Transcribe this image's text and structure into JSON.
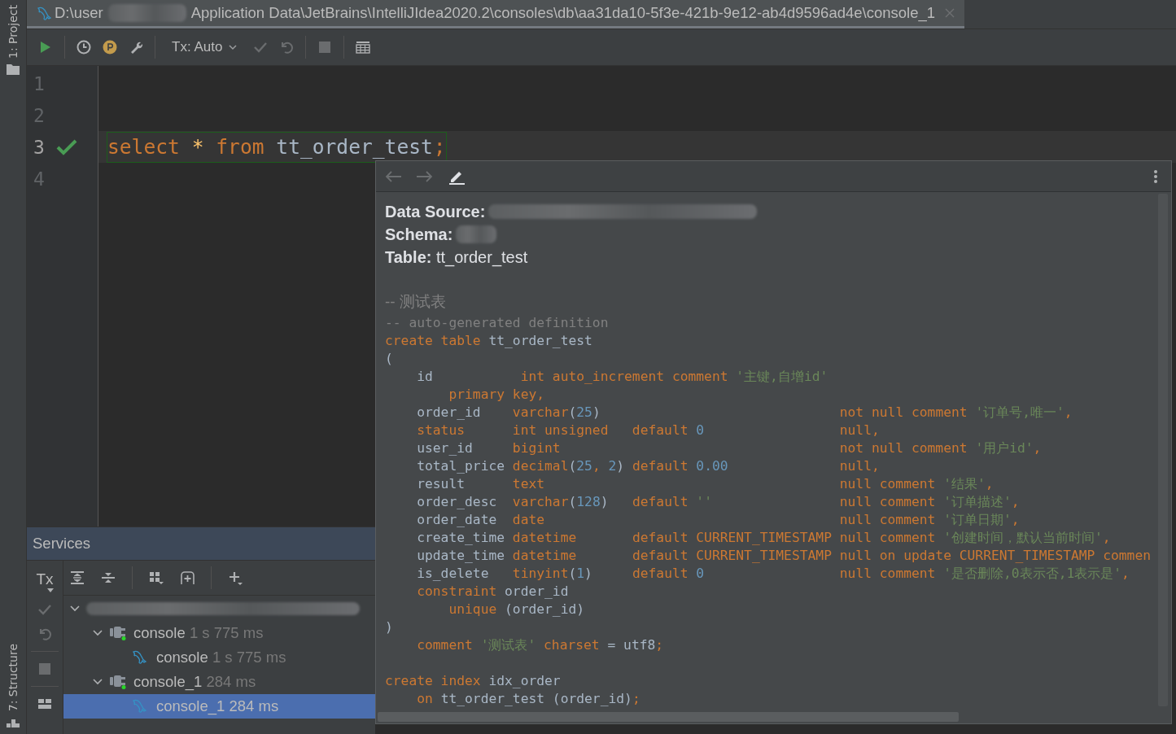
{
  "tool_stripe": {
    "top": {
      "label": "1: Project"
    },
    "bottom": {
      "label": "7: Structure"
    }
  },
  "tab": {
    "path_start": "D:\\user",
    "path_end": "Application Data\\JetBrains\\IntelliJIdea2020.2\\consoles\\db\\aa31da10-5f3e-421b-9e12-ab4d9596ad4e\\console_1",
    "selected": true
  },
  "toolbar": {
    "buttons": [
      {
        "kind": "run",
        "disabled": false
      },
      {
        "kind": "sep"
      },
      {
        "kind": "history",
        "disabled": false
      },
      {
        "kind": "profile",
        "disabled": false
      },
      {
        "kind": "settings",
        "disabled": false
      },
      {
        "kind": "sep"
      },
      {
        "kind": "tx",
        "label": "Tx: Auto",
        "disabled": false
      },
      {
        "kind": "commit",
        "disabled": true
      },
      {
        "kind": "rollback",
        "disabled": true
      },
      {
        "kind": "sep"
      },
      {
        "kind": "stop",
        "disabled": true
      },
      {
        "kind": "sep"
      },
      {
        "kind": "table",
        "disabled": false
      }
    ]
  },
  "editor": {
    "lines": [
      {
        "number": "1",
        "current": false,
        "ok": false
      },
      {
        "number": "2",
        "current": false,
        "ok": false
      },
      {
        "number": "3",
        "current": true,
        "ok": true,
        "tokens": [
          {
            "text": "select",
            "kind": "kw"
          },
          {
            "text": " *",
            "kind": "star"
          },
          {
            "text": " from",
            "kind": "kw"
          },
          {
            "text": " tt_order_test",
            "kind": "id"
          },
          {
            "text": ";",
            "kind": "kw"
          }
        ]
      },
      {
        "number": "4",
        "current": false,
        "ok": false
      }
    ]
  },
  "services": {
    "title": "Services",
    "side_buttons": [
      {
        "kind": "tx",
        "label": "Tx",
        "disabled": false
      },
      {
        "kind": "commit",
        "disabled": true
      },
      {
        "kind": "rollback",
        "disabled": true
      },
      {
        "kind": "sep"
      },
      {
        "kind": "stop",
        "disabled": true
      },
      {
        "kind": "sep"
      },
      {
        "kind": "layout",
        "disabled": false
      }
    ],
    "toolbar": [
      {
        "kind": "expand"
      },
      {
        "kind": "collapse"
      },
      {
        "kind": "sep"
      },
      {
        "kind": "group"
      },
      {
        "kind": "new-session"
      },
      {
        "kind": "sep"
      },
      {
        "kind": "add"
      }
    ],
    "tree": [
      {
        "kind": "datasource",
        "expanded": true,
        "selected": false,
        "children": [
          {
            "kind": "session",
            "label": "console",
            "time": "1 s 775 ms",
            "expanded": true,
            "selected": false,
            "children": [
              {
                "kind": "console",
                "label": "console",
                "time": "1 s 775 ms",
                "selected": false
              }
            ]
          },
          {
            "kind": "session",
            "label": "console_1",
            "time": "284 ms",
            "expanded": true,
            "selected": false,
            "children": [
              {
                "kind": "console",
                "label": "console_1",
                "time": "284 ms",
                "selected": true
              }
            ]
          }
        ]
      }
    ]
  },
  "popup": {
    "back_disabled": true,
    "forward_disabled": true,
    "fields": [
      {
        "label": "Data Source:",
        "redacted": true
      },
      {
        "label": "Schema:",
        "redacted": true
      },
      {
        "label": "Table:",
        "value": "tt_order_test",
        "redacted": false
      }
    ],
    "comment": "-- 测试表",
    "code": [
      {
        "lines": [
          [
            {
              "text": "-- auto-generated definition",
              "kind": "cm"
            }
          ],
          [
            {
              "text": "create table",
              "kind": "kw"
            },
            {
              "text": " tt_order_test",
              "kind": "id"
            }
          ],
          [
            {
              "text": "(",
              "kind": "id"
            }
          ],
          [
            {
              "text": "    id           ",
              "kind": "id"
            },
            {
              "text": "int auto_increment comment ",
              "kind": "kw"
            },
            {
              "text": "'主键,自增id'",
              "kind": "str"
            }
          ],
          [
            {
              "text": "        primary key,",
              "kind": "kw"
            }
          ],
          [
            {
              "text": "    order_id    ",
              "kind": "id"
            },
            {
              "text": "varchar",
              "kind": "kw"
            },
            {
              "text": "(",
              "kind": "id"
            },
            {
              "text": "25",
              "kind": "num"
            },
            {
              "text": ")                              ",
              "kind": "id"
            },
            {
              "text": "not null comment ",
              "kind": "kw"
            },
            {
              "text": "'订单号,唯一'",
              "kind": "str"
            },
            {
              "text": ",",
              "kind": "kw"
            }
          ],
          [
            {
              "text": "    status      int unsigned   default ",
              "kind": "kw"
            },
            {
              "text": "0",
              "kind": "num"
            },
            {
              "text": "                 null,",
              "kind": "kw"
            }
          ],
          [
            {
              "text": "    user_id     ",
              "kind": "id"
            },
            {
              "text": "bigint                                   not null comment ",
              "kind": "kw"
            },
            {
              "text": "'用户id'",
              "kind": "str"
            },
            {
              "text": ",",
              "kind": "kw"
            }
          ],
          [
            {
              "text": "    total_price ",
              "kind": "id"
            },
            {
              "text": "decimal",
              "kind": "kw"
            },
            {
              "text": "(",
              "kind": "id"
            },
            {
              "text": "25",
              "kind": "num"
            },
            {
              "text": ", ",
              "kind": "kw"
            },
            {
              "text": "2",
              "kind": "num"
            },
            {
              "text": ") ",
              "kind": "id"
            },
            {
              "text": "default ",
              "kind": "kw"
            },
            {
              "text": "0.00",
              "kind": "num"
            },
            {
              "text": "              null,",
              "kind": "kw"
            }
          ],
          [
            {
              "text": "    result      ",
              "kind": "id"
            },
            {
              "text": "text                                     null comment ",
              "kind": "kw"
            },
            {
              "text": "'结果'",
              "kind": "str"
            },
            {
              "text": ",",
              "kind": "kw"
            }
          ],
          [
            {
              "text": "    order_desc  ",
              "kind": "id"
            },
            {
              "text": "varchar",
              "kind": "kw"
            },
            {
              "text": "(",
              "kind": "id"
            },
            {
              "text": "128",
              "kind": "num"
            },
            {
              "text": ")   ",
              "kind": "id"
            },
            {
              "text": "default ",
              "kind": "kw"
            },
            {
              "text": "''",
              "kind": "str"
            },
            {
              "text": "                null comment ",
              "kind": "kw"
            },
            {
              "text": "'订单描述'",
              "kind": "str"
            },
            {
              "text": ",",
              "kind": "kw"
            }
          ],
          [
            {
              "text": "    order_date  ",
              "kind": "id"
            },
            {
              "text": "date                                     null comment ",
              "kind": "kw"
            },
            {
              "text": "'订单日期'",
              "kind": "str"
            },
            {
              "text": ",",
              "kind": "kw"
            }
          ],
          [
            {
              "text": "    create_time ",
              "kind": "id"
            },
            {
              "text": "datetime       default CURRENT_TIMESTAMP null comment ",
              "kind": "kw"
            },
            {
              "text": "'创建时间，默认当前时间'",
              "kind": "str"
            },
            {
              "text": ",",
              "kind": "kw"
            }
          ],
          [
            {
              "text": "    update_time ",
              "kind": "id"
            },
            {
              "text": "datetime       default CURRENT_TIMESTAMP null on update CURRENT_TIMESTAMP commen",
              "kind": "kw"
            }
          ],
          [
            {
              "text": "    is_delete   ",
              "kind": "id"
            },
            {
              "text": "tinyint",
              "kind": "kw"
            },
            {
              "text": "(",
              "kind": "id"
            },
            {
              "text": "1",
              "kind": "num"
            },
            {
              "text": ")     ",
              "kind": "id"
            },
            {
              "text": "default ",
              "kind": "kw"
            },
            {
              "text": "0",
              "kind": "num"
            },
            {
              "text": "                 null comment ",
              "kind": "kw"
            },
            {
              "text": "'是否删除,0表示否,1表示是'",
              "kind": "str"
            },
            {
              "text": ",",
              "kind": "kw"
            }
          ],
          [
            {
              "text": "    constraint",
              "kind": "kw"
            },
            {
              "text": " order_id",
              "kind": "id"
            }
          ],
          [
            {
              "text": "        unique",
              "kind": "kw"
            },
            {
              "text": " (order_id)",
              "kind": "id"
            }
          ],
          [
            {
              "text": ")",
              "kind": "id"
            }
          ],
          [
            {
              "text": "    comment ",
              "kind": "kw"
            },
            {
              "text": "'测试表'",
              "kind": "str"
            },
            {
              "text": " charset",
              "kind": "kw"
            },
            {
              "text": " = utf8",
              "kind": "id"
            },
            {
              "text": ";",
              "kind": "kw"
            }
          ]
        ]
      },
      {
        "lines": [
          [
            {
              "text": "create index",
              "kind": "kw"
            },
            {
              "text": " idx_order",
              "kind": "id"
            }
          ],
          [
            {
              "text": "    on",
              "kind": "kw"
            },
            {
              "text": " tt_order_test (order_id)",
              "kind": "id"
            },
            {
              "text": ";",
              "kind": "kw"
            }
          ]
        ]
      }
    ]
  }
}
